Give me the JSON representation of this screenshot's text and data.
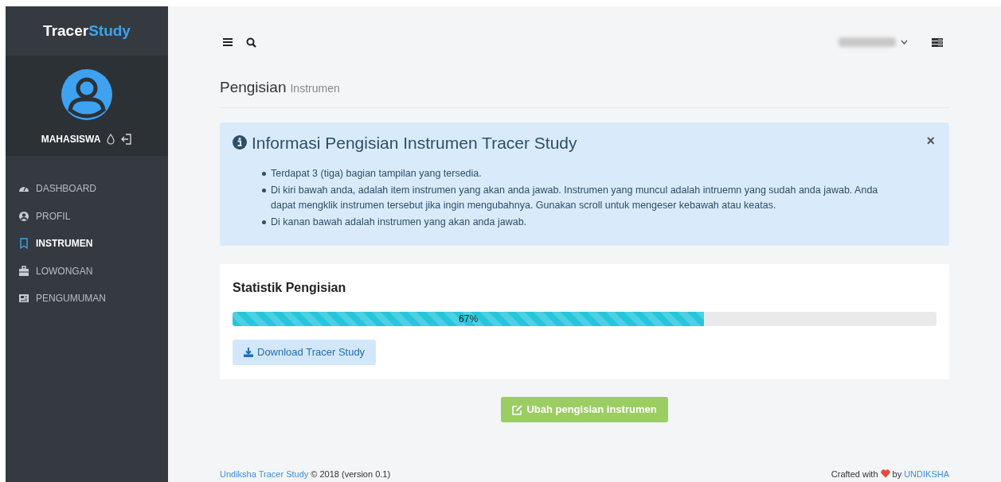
{
  "brand": {
    "first": "Tracer",
    "second": "Study"
  },
  "profile": {
    "role": "MAHASISWA"
  },
  "menu": [
    {
      "label": "DASHBOARD",
      "selected": false
    },
    {
      "label": "PROFIL",
      "selected": false
    },
    {
      "label": "INSTRUMEN",
      "selected": true
    },
    {
      "label": "LOWONGAN",
      "selected": false
    },
    {
      "label": "PENGUMUMAN",
      "selected": false
    }
  ],
  "page_header": {
    "title": "Pengisian",
    "subtitle": "Instrumen"
  },
  "alert": {
    "title": "Informasi Pengisian Instrumen Tracer Study",
    "close": "×",
    "items": [
      "Terdapat 3 (tiga) bagian tampilan yang tersedia.",
      "Di kiri bawah anda, adalah item instrumen yang akan anda jawab. Instrumen yang muncul adalah intruemn yang sudah anda jawab. Anda dapat mengklik instrumen tersebut jika ingin mengubahnya. Gunakan scroll untuk mengeser kebawah atau keatas.",
      "Di kanan bawah adalah instrumen yang akan anda jawab."
    ]
  },
  "stats": {
    "title": "Statistik Pengisian",
    "progress": {
      "level": 0.67,
      "label": "67%"
    },
    "download_button": "Download Tracer Study"
  },
  "edit_button": "Ubah pengisian instrumen",
  "footer": {
    "link": "Undiksha Tracer Study",
    "text": "© 2018 (version 0.1)",
    "crafted": "Crafted with",
    "by": "by",
    "org": "UNDIKSHA"
  }
}
